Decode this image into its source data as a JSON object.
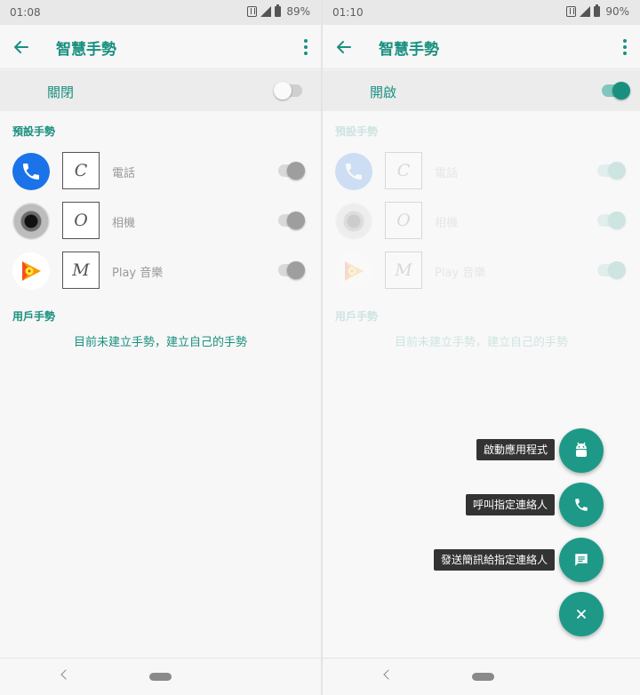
{
  "colors": {
    "accent": "#19907f",
    "fab": "#1e9988",
    "switch_off_track": "#cfcfcf",
    "switch_off_knob": "#ffffff",
    "switch_on_track": "#7fc7bd",
    "switch_on_knob": "#19907f"
  },
  "left": {
    "status": {
      "time": "01:08",
      "battery": "89%"
    },
    "appbar": {
      "title": "智慧手勢"
    },
    "master": {
      "label": "關閉",
      "on": false
    },
    "preset_title": "預設手勢",
    "gestures": [
      {
        "app": "電話",
        "letter": "C",
        "icon": "phone-icon",
        "on": false
      },
      {
        "app": "相機",
        "letter": "O",
        "icon": "camera-icon",
        "on": false
      },
      {
        "app": "Play 音樂",
        "letter": "M",
        "icon": "play-music-icon",
        "on": false
      }
    ],
    "user_title": "用戶手勢",
    "empty_message": "目前未建立手勢，建立自己的手勢"
  },
  "right": {
    "status": {
      "time": "01:10",
      "battery": "90%"
    },
    "appbar": {
      "title": "智慧手勢"
    },
    "master": {
      "label": "開啟",
      "on": true
    },
    "preset_title": "預設手勢",
    "gestures": [
      {
        "app": "電話",
        "letter": "C",
        "icon": "phone-icon",
        "on": true
      },
      {
        "app": "相機",
        "letter": "O",
        "icon": "camera-icon",
        "on": true
      },
      {
        "app": "Play 音樂",
        "letter": "M",
        "icon": "play-music-icon",
        "on": true
      }
    ],
    "user_title": "用戶手勢",
    "empty_message": "目前未建立手勢，建立自己的手勢",
    "fab_menu": [
      {
        "label": "啟動應用程式",
        "icon": "android-icon"
      },
      {
        "label": "呼叫指定連絡人",
        "icon": "phone-icon"
      },
      {
        "label": "發送簡訊給指定連絡人",
        "icon": "message-icon"
      }
    ],
    "fab_close_icon": "close-icon"
  }
}
